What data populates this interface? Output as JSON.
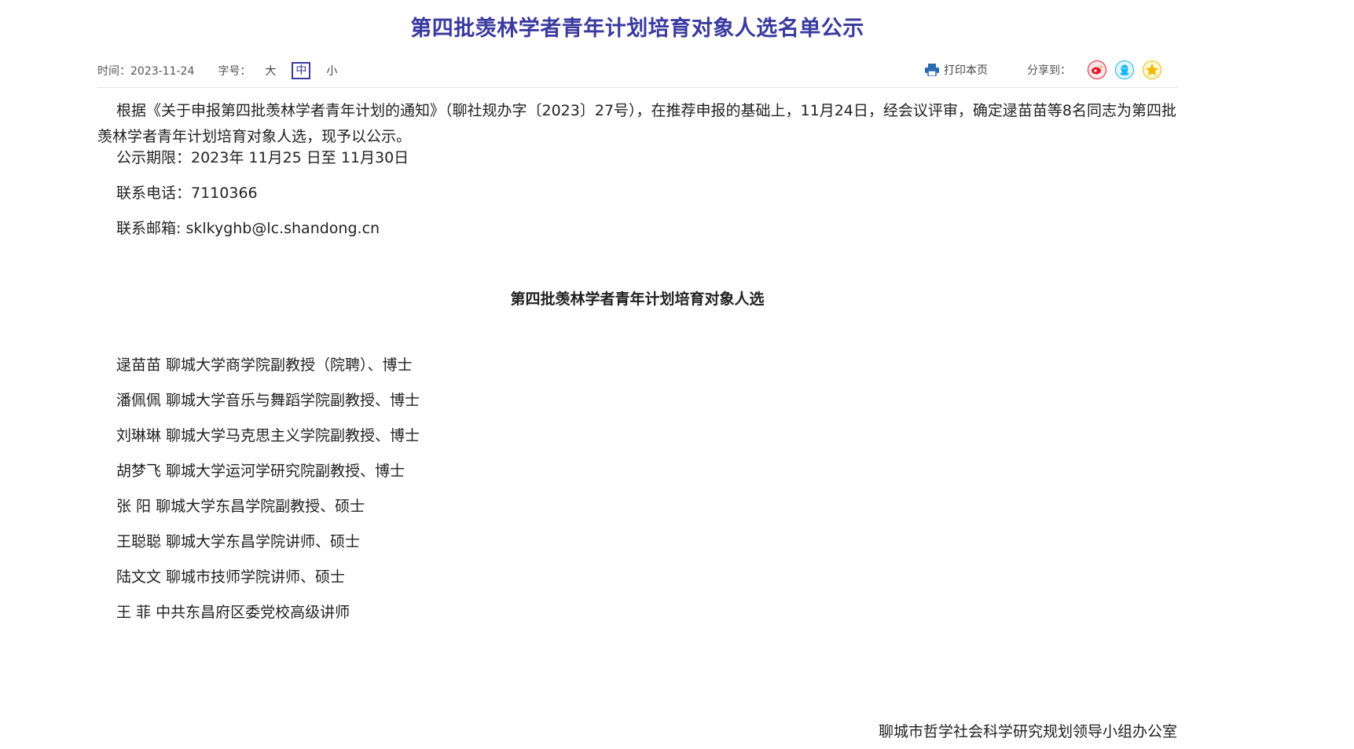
{
  "article": {
    "title": "第四批羡林学者青年计划培育对象人选名单公示",
    "time_label": "时间：2023-11-24",
    "font_size_label": "字号：",
    "font_sizes": [
      "大",
      "中",
      "小"
    ],
    "print_label": "打印本页",
    "share_label": "分享到：",
    "share_icons": [
      "weibo-icon",
      "qq-icon",
      "qzone-icon"
    ],
    "intro": "根据《关于申报第四批羡林学者青年计划的通知》（聊社规办字〔2023〕27号），在推荐申报的基础上，11月24日，经会议评审，确定逯苗苗等8名同志为第四批羡林学者青年计划培育对象人选，现予以公示。",
    "period": "公示期限：2023年 11月25 日至 11月30日",
    "phone": "联系电话：7110366",
    "email": "联系邮箱: sklkyghb@lc.shandong.cn",
    "list_title": "第四批羡林学者青年计划培育对象人选",
    "people": [
      "逯苗苗  聊城大学商学院副教授（院聘）、博士",
      "潘佩佩  聊城大学音乐与舞蹈学院副教授、博士",
      "刘琳琳  聊城大学马克思主义学院副教授、博士",
      "胡梦飞  聊城大学运河学研究院副教授、博士",
      "张  阳  聊城大学东昌学院副教授、硕士",
      "王聪聪  聊城大学东昌学院讲师、硕士",
      "陆文文  聊城市技师学院讲师、硕士",
      "王  菲  中共东昌府区委党校高级讲师"
    ],
    "signature": "聊城市哲学社会科学研究规划领导小组办公室"
  },
  "colors": {
    "title": "#3a3aa0",
    "weibo": "#e6162d",
    "qq": "#12b7f5",
    "qzone": "#f5b800"
  }
}
